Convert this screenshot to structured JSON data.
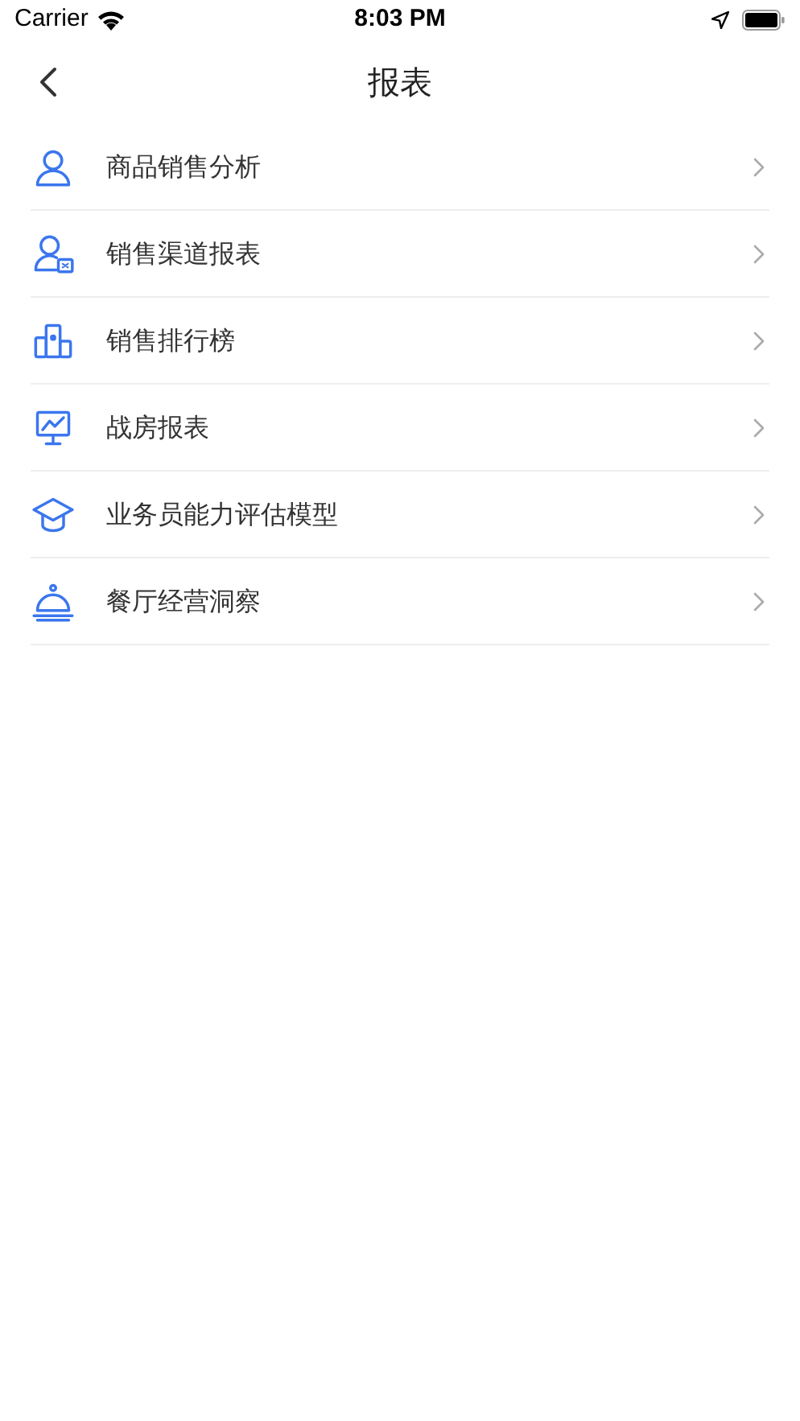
{
  "status_bar": {
    "carrier": "Carrier",
    "time": "8:03 PM"
  },
  "nav_bar": {
    "title": "报表"
  },
  "items": [
    {
      "kind": "person",
      "label": "商品销售分析"
    },
    {
      "kind": "person-card",
      "label": "销售渠道报表"
    },
    {
      "kind": "podium",
      "label": "销售排行榜"
    },
    {
      "kind": "monitor",
      "label": "战房报表"
    },
    {
      "kind": "cap",
      "label": "业务员能力评估模型"
    },
    {
      "kind": "cloche",
      "label": "餐厅经营洞察"
    }
  ]
}
